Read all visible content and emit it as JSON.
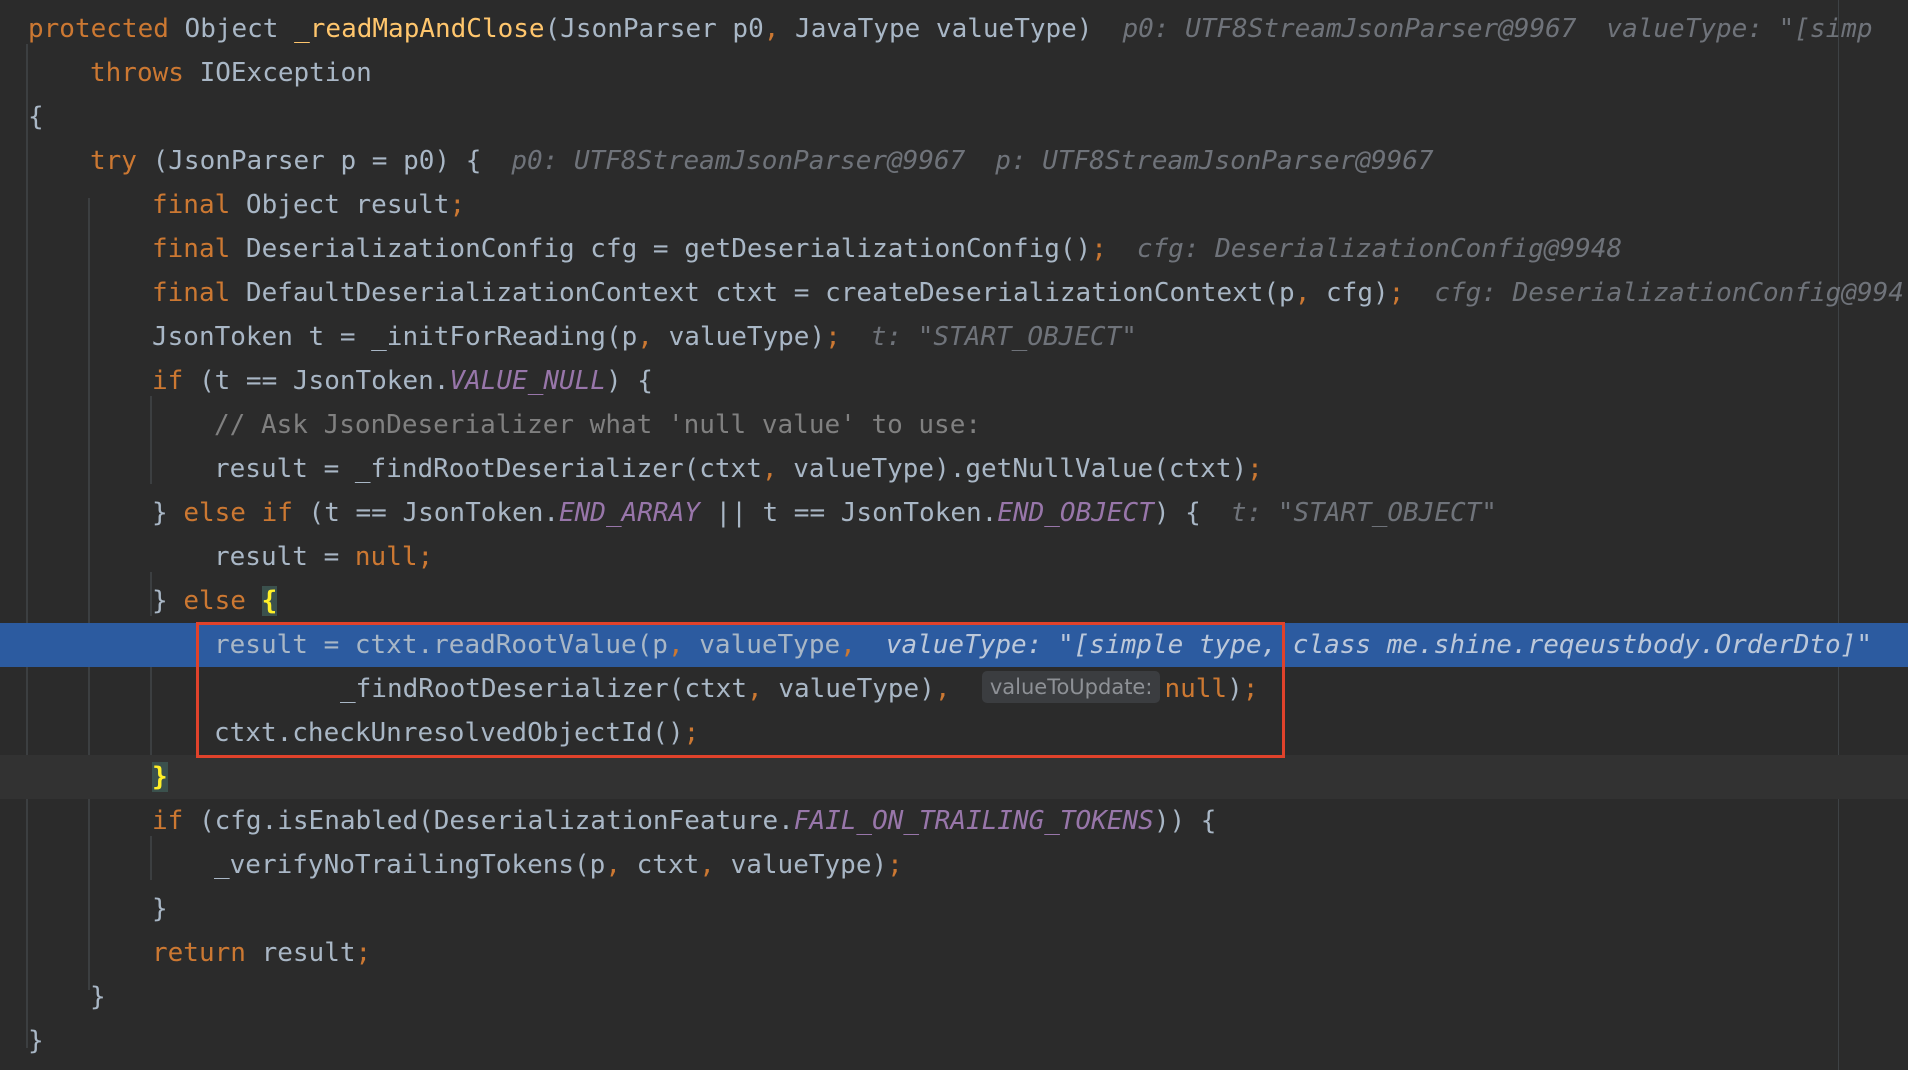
{
  "lines": {
    "l1": {
      "kw": "protected",
      "a": " Object ",
      "fn": "_readMapAndClose",
      "b": "(JsonParser p0",
      "c": ", ",
      "d": "JavaType valueType)",
      "hint1": "p0: UTF8StreamJsonParser@9967",
      "hint2": "valueType: \"[simp"
    },
    "l2": {
      "kw": "throws",
      "a": " IOException"
    },
    "l3": {
      "a": "{"
    },
    "l4": {
      "kw": "try",
      "a": " (JsonParser p = p0) {",
      "hint1": "p0: UTF8StreamJsonParser@9967",
      "hint2": "p: UTF8StreamJsonParser@9967"
    },
    "l5": {
      "kw": "final",
      "a": " Object result",
      "p": ";"
    },
    "l6": {
      "kw": "final",
      "a": " DeserializationConfig cfg = getDeserializationConfig()",
      "p": ";",
      "hint1": "cfg: DeserializationConfig@9948"
    },
    "l7": {
      "kw": "final",
      "a": " DefaultDeserializationContext ctxt = createDeserializationContext(p",
      "c": ", ",
      "b": "cfg)",
      "p": ";",
      "hint1": "cfg: DeserializationConfig@994"
    },
    "l8": {
      "a": "JsonToken t = _initForReading(p",
      "c": ", ",
      "b": "valueType)",
      "p": ";",
      "hint1": "t: \"START_OBJECT\""
    },
    "l9": {
      "kw": "if",
      "a": " (t == JsonToken.",
      "st": "VALUE_NULL",
      "b": ") {"
    },
    "l10": {
      "cm": "// Ask JsonDeserializer what 'null value' to use:"
    },
    "l11": {
      "a": "result = _findRootDeserializer(ctxt",
      "c": ", ",
      "b": "valueType).getNullValue(ctxt)",
      "p": ";"
    },
    "l12": {
      "a": "} ",
      "kw": "else if",
      "b": " (t == JsonToken.",
      "st": "END_ARRAY",
      "c": " || t == JsonToken.",
      "st2": "END_OBJECT",
      "d": ") {",
      "hint1": "t: \"START_OBJECT\""
    },
    "l13": {
      "a": "result = ",
      "kw": "null",
      "p": ";"
    },
    "l14": {
      "a": "} ",
      "kw": "else",
      "brace": "{"
    },
    "l15": {
      "a": "result = ctxt.readRootValue(p",
      "c": ", ",
      "b": "valueType",
      "c2": ",",
      "hint1": "valueType: \"[simple type, class me.shine.reqeustbody.OrderDto]\""
    },
    "l16": {
      "a": "_findRootDeserializer(ctxt",
      "c": ", ",
      "b": "valueType)",
      "c2": ", ",
      "inlay": "valueToUpdate:",
      "kw": "null",
      "d": ")",
      "p": ";"
    },
    "l17": {
      "a": "ctxt.checkUnresolvedObjectId()",
      "p": ";"
    },
    "l18": {
      "brace": "}"
    },
    "l19": {
      "kw": "if",
      "a": " (cfg.isEnabled(DeserializationFeature.",
      "st": "FAIL_ON_TRAILING_TOKENS",
      "b": ")) {"
    },
    "l20": {
      "a": "_verifyNoTrailingTokens(p",
      "c": ", ",
      "b": "ctxt",
      "c2": ", ",
      "d": "valueType)",
      "p": ";"
    },
    "l21": {
      "a": "}"
    },
    "l22": {
      "kw": "return",
      "a": " result",
      "p": ";"
    },
    "l23": {
      "a": "}"
    },
    "l24": {
      "a": "}"
    }
  },
  "colors": {
    "background": "#2b2b2b",
    "keyword": "#cc7832",
    "method_declaration": "#ffc66d",
    "static_field": "#9876aa",
    "comment": "#808080",
    "execution_line": "#2c5ba0",
    "selection_box": "#e0422b"
  }
}
